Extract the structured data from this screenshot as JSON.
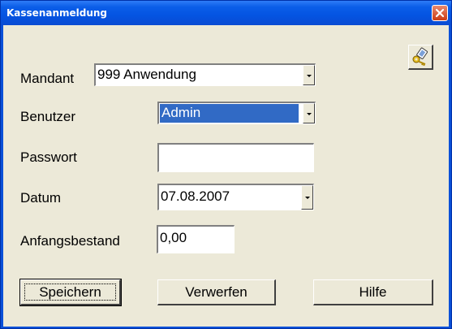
{
  "window": {
    "title": "Kassenanmeldung"
  },
  "form": {
    "mandant": {
      "label": "Mandant",
      "value": "999 Anwendung"
    },
    "benutzer": {
      "label": "Benutzer",
      "value": "Admin"
    },
    "passwort": {
      "label": "Passwort",
      "value": ""
    },
    "datum": {
      "label": "Datum",
      "value": "07.08.2007"
    },
    "anfangsbestand": {
      "label": "Anfangsbestand",
      "value": "0,00"
    }
  },
  "buttons": {
    "save": "Speichern",
    "discard": "Verwerfen",
    "help": "Hilfe"
  },
  "icons": {
    "close": "close-icon",
    "login": "key-login-icon"
  },
  "colors": {
    "titlebar": "#0a50d8",
    "selection": "#316ac5",
    "dialog": "#ece9d8"
  }
}
